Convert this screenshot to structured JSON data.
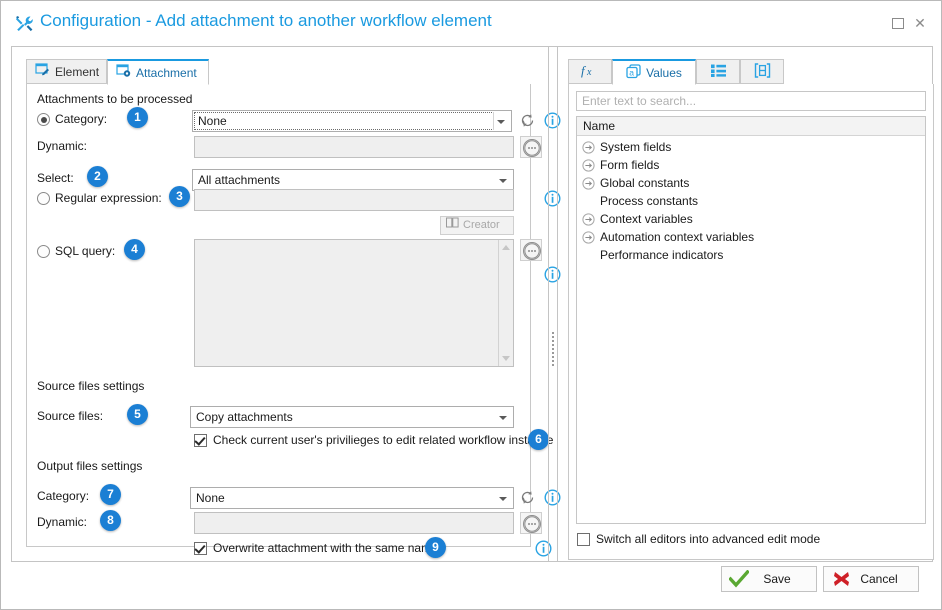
{
  "window": {
    "title": "Configuration - Add attachment to another workflow element",
    "title_icon": "tools-icon",
    "maximize_label": "Maximize",
    "close_label": "Close"
  },
  "left_panel": {
    "tabs": [
      {
        "label": "Element",
        "icon": "element-pencil-icon",
        "active": false
      },
      {
        "label": "Attachment",
        "icon": "attachment-gear-icon",
        "active": true
      }
    ],
    "sections": {
      "attachments_header": "Attachments to be processed",
      "source_files_header": "Source files settings",
      "output_files_header": "Output files settings"
    },
    "fields": {
      "category_label": "Category:",
      "category_value": "None",
      "category_badge": "1",
      "dynamic_label": "Dynamic:",
      "dynamic_value": "",
      "select_label": "Select:",
      "select_value": "All attachments",
      "select_badge": "2",
      "regex_label": "Regular expression:",
      "regex_value": "",
      "regex_badge": "3",
      "creator_label": "Creator",
      "sql_label": "SQL query:",
      "sql_value": "",
      "sql_badge": "4",
      "source_files_label": "Source files:",
      "source_files_value": "Copy attachments",
      "source_files_badge": "5",
      "check_privileges_label": "Check current user's privilieges to edit related workflow instance",
      "check_privileges_badge": "6",
      "check_privileges_checked": true,
      "out_category_label": "Category:",
      "out_category_value": "None",
      "out_category_badge": "7",
      "out_dynamic_label": "Dynamic:",
      "out_dynamic_value": "",
      "out_dynamic_badge": "8",
      "overwrite_label": "Overwrite attachment with the same name",
      "overwrite_badge": "9",
      "overwrite_checked": true
    },
    "radio_selected": "category"
  },
  "right_panel": {
    "tabs": [
      {
        "label": "",
        "icon": "function-fx-icon",
        "active": false
      },
      {
        "label": "Values",
        "icon": "values-a-icon",
        "active": true
      },
      {
        "label": "",
        "icon": "list-items-icon",
        "active": false
      },
      {
        "label": "",
        "icon": "bracket-box-icon",
        "active": false
      }
    ],
    "search_placeholder": "Enter text to search...",
    "search_value": "",
    "grid_header": "Name",
    "tree_items": [
      {
        "label": "System fields",
        "expandable": true
      },
      {
        "label": "Form fields",
        "expandable": true
      },
      {
        "label": "Global constants",
        "expandable": true
      },
      {
        "label": "Process constants",
        "expandable": false
      },
      {
        "label": "Context variables",
        "expandable": true
      },
      {
        "label": "Automation context variables",
        "expandable": true
      },
      {
        "label": "Performance indicators",
        "expandable": false
      }
    ],
    "advanced_mode_label": "Switch all editors into advanced edit mode",
    "advanced_mode_checked": false
  },
  "footer": {
    "save_label": "Save",
    "cancel_label": "Cancel"
  },
  "colors": {
    "title_blue": "#1a9ae0",
    "badge_blue": "#1b7fd4",
    "info_blue": "#29a3e3",
    "save_green": "#5aa832",
    "cancel_red": "#cf2027",
    "border_gray": "#c4c4c4"
  }
}
